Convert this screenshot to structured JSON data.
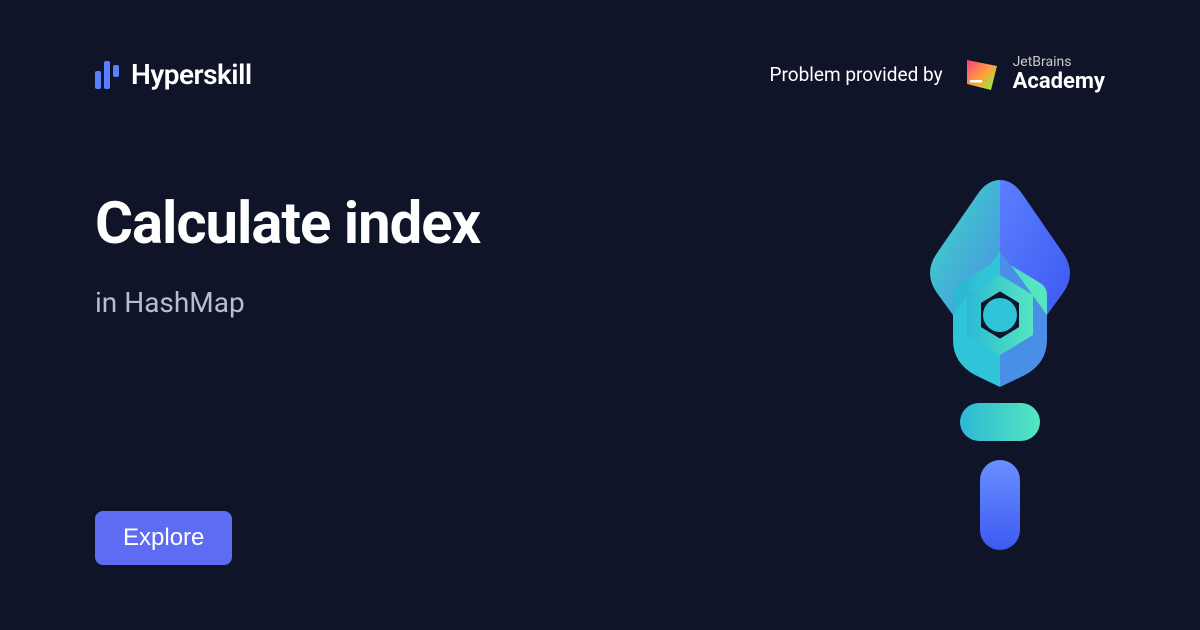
{
  "header": {
    "brand": "Hyperskill",
    "provided_by": "Problem provided by",
    "partner_line1": "JetBrains",
    "partner_line2": "Academy"
  },
  "main": {
    "title": "Calculate index",
    "subtitle": "in HashMap"
  },
  "cta": {
    "explore": "Explore"
  }
}
